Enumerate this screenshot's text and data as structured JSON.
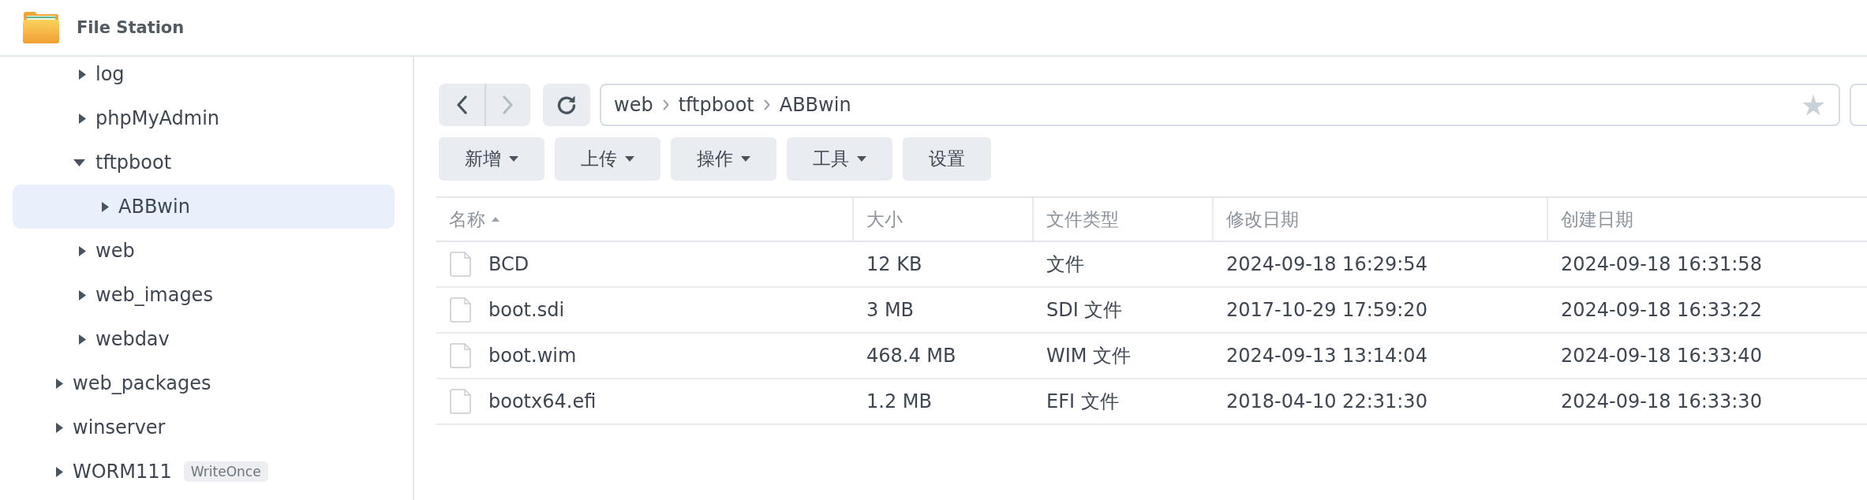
{
  "window": {
    "title": "File Station"
  },
  "folder_tree": [
    {
      "children": [
        {
          "label": "log",
          "expanded": false,
          "selected": false
        },
        {
          "label": "phpMyAdmin",
          "expanded": false,
          "selected": false
        },
        {
          "label": "tftpboot",
          "expanded": true,
          "selected": false,
          "children": [
            {
              "label": "ABBwin",
              "expanded": false,
              "selected": true
            }
          ]
        },
        {
          "label": "web",
          "expanded": false,
          "selected": false
        },
        {
          "label": "web_images",
          "expanded": false,
          "selected": false
        },
        {
          "label": "webdav",
          "expanded": false,
          "selected": false
        }
      ]
    },
    {
      "label": "web_packages",
      "expanded": false,
      "selected": false
    },
    {
      "label": "winserver",
      "expanded": false,
      "selected": false
    },
    {
      "label": "WORM111",
      "expanded": false,
      "selected": false,
      "badge": "WriteOnce"
    }
  ],
  "navigation": [
    {
      "kind": "back",
      "disabled": false
    },
    {
      "kind": "forward",
      "disabled": true
    }
  ],
  "address_bar": {
    "segments": [
      "web",
      "tftpboot",
      "ABBwin"
    ],
    "favorite": false
  },
  "toolbar": [
    {
      "label": "新增",
      "menu": true
    },
    {
      "label": "上传",
      "menu": true
    },
    {
      "label": "操作",
      "menu": true
    },
    {
      "label": "工具",
      "menu": true
    },
    {
      "label": "设置",
      "menu": false
    }
  ],
  "table": {
    "columns": [
      {
        "label": "名称",
        "sorted": true,
        "descending": false
      },
      {
        "label": "大小",
        "sorted": false
      },
      {
        "label": "文件类型",
        "sorted": false
      },
      {
        "label": "修改日期",
        "sorted": false
      },
      {
        "label": "创建日期",
        "sorted": false
      }
    ],
    "rows": [
      {
        "name": "BCD",
        "size": "12 KB",
        "type": "文件",
        "modified": "2024-09-18 16:29:54",
        "created": "2024-09-18 16:31:58"
      },
      {
        "name": "boot.sdi",
        "size": "3 MB",
        "type": "SDI 文件",
        "modified": "2017-10-29 17:59:20",
        "created": "2024-09-18 16:33:22"
      },
      {
        "name": "boot.wim",
        "size": "468.4 MB",
        "type": "WIM 文件",
        "modified": "2024-09-13 13:14:04",
        "created": "2024-09-18 16:33:40"
      },
      {
        "name": "bootx64.efi",
        "size": "1.2 MB",
        "type": "EFI 文件",
        "modified": "2018-04-10 22:31:30",
        "created": "2024-09-18 16:33:30"
      }
    ]
  }
}
